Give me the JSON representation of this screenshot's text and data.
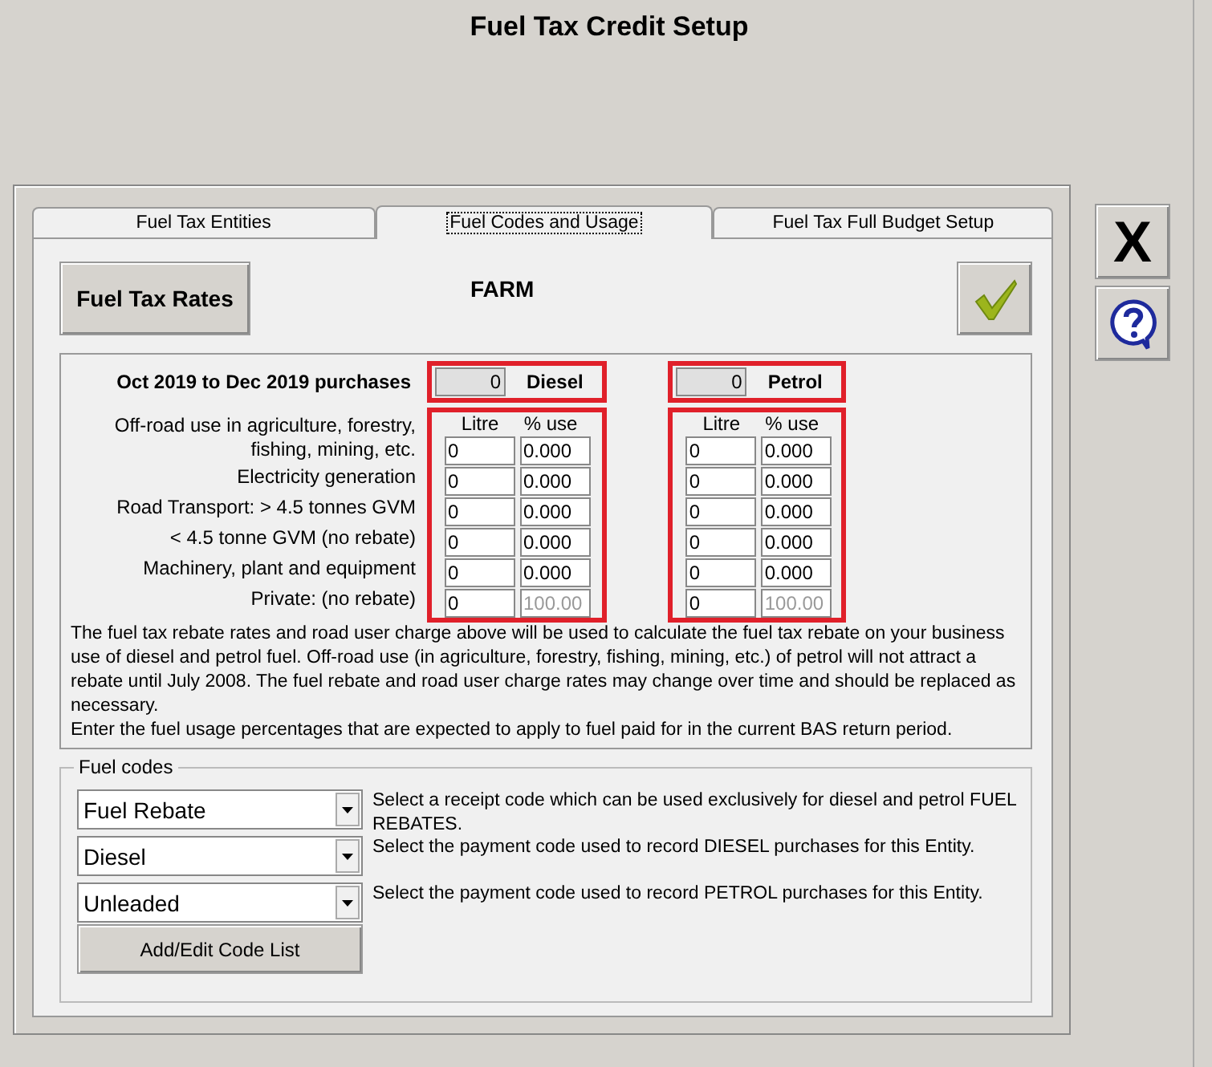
{
  "title": "Fuel Tax Credit Setup",
  "tabs": [
    {
      "label": "Fuel Tax Entities",
      "selected": false
    },
    {
      "label": "Fuel Codes and Usage",
      "selected": true
    },
    {
      "label": "Fuel Tax Full Budget Setup",
      "selected": false
    }
  ],
  "rates_button": "Fuel Tax Rates",
  "entity": "FARM",
  "close_button": "X",
  "purchases_label": "Oct 2019 to Dec 2019 purchases",
  "usage_labels": [
    "Off-road use in agriculture, forestry, fishing, mining, etc.",
    "Electricity generation",
    "Road Transport: > 4.5 tonnes GVM",
    "< 4.5 tonne GVM (no rebate)",
    "Machinery, plant and equipment",
    "Private: (no rebate)"
  ],
  "fuels": [
    {
      "name": "Diesel",
      "total": "0",
      "highlighted": true,
      "columns": [
        "Litre",
        "% use"
      ],
      "rows": [
        {
          "litre": "0",
          "percent": "0.000",
          "disabled": false
        },
        {
          "litre": "0",
          "percent": "0.000",
          "disabled": false
        },
        {
          "litre": "0",
          "percent": "0.000",
          "disabled": false
        },
        {
          "litre": "0",
          "percent": "0.000",
          "disabled": false
        },
        {
          "litre": "0",
          "percent": "0.000",
          "disabled": false
        },
        {
          "litre": "0",
          "percent": "100.00",
          "disabled": true
        }
      ]
    },
    {
      "name": "Petrol",
      "total": "0",
      "highlighted": true,
      "columns": [
        "Litre",
        "% use"
      ],
      "rows": [
        {
          "litre": "0",
          "percent": "0.000",
          "disabled": false
        },
        {
          "litre": "0",
          "percent": "0.000",
          "disabled": false
        },
        {
          "litre": "0",
          "percent": "0.000",
          "disabled": false
        },
        {
          "litre": "0",
          "percent": "0.000",
          "disabled": false
        },
        {
          "litre": "0",
          "percent": "0.000",
          "disabled": false
        },
        {
          "litre": "0",
          "percent": "100.00",
          "disabled": true
        }
      ]
    }
  ],
  "note": "The fuel tax rebate rates and road user charge above will be used to calculate the fuel tax rebate on your business use of diesel and petrol fuel. Off-road use (in agriculture, forestry, fishing, mining, etc.) of petrol will not attract a rebate until July 2008. The fuel rebate and road user charge rates may change over time and should be replaced as necessary.",
  "note_2": "Enter the fuel usage percentages that are expected to apply to fuel paid for in the current BAS return period.",
  "fuel_codes": {
    "title": "Fuel codes",
    "selects": [
      {
        "value": "Fuel Rebate",
        "description": "Select a receipt code which can be used exclusively for diesel and petrol FUEL REBATES."
      },
      {
        "value": "Diesel",
        "description": "Select the payment code used to record DIESEL purchases for this Entity."
      },
      {
        "value": "Unleaded",
        "description": "Select the payment code used to record PETROL purchases for this Entity."
      }
    ],
    "button": "Add/Edit Code List"
  }
}
